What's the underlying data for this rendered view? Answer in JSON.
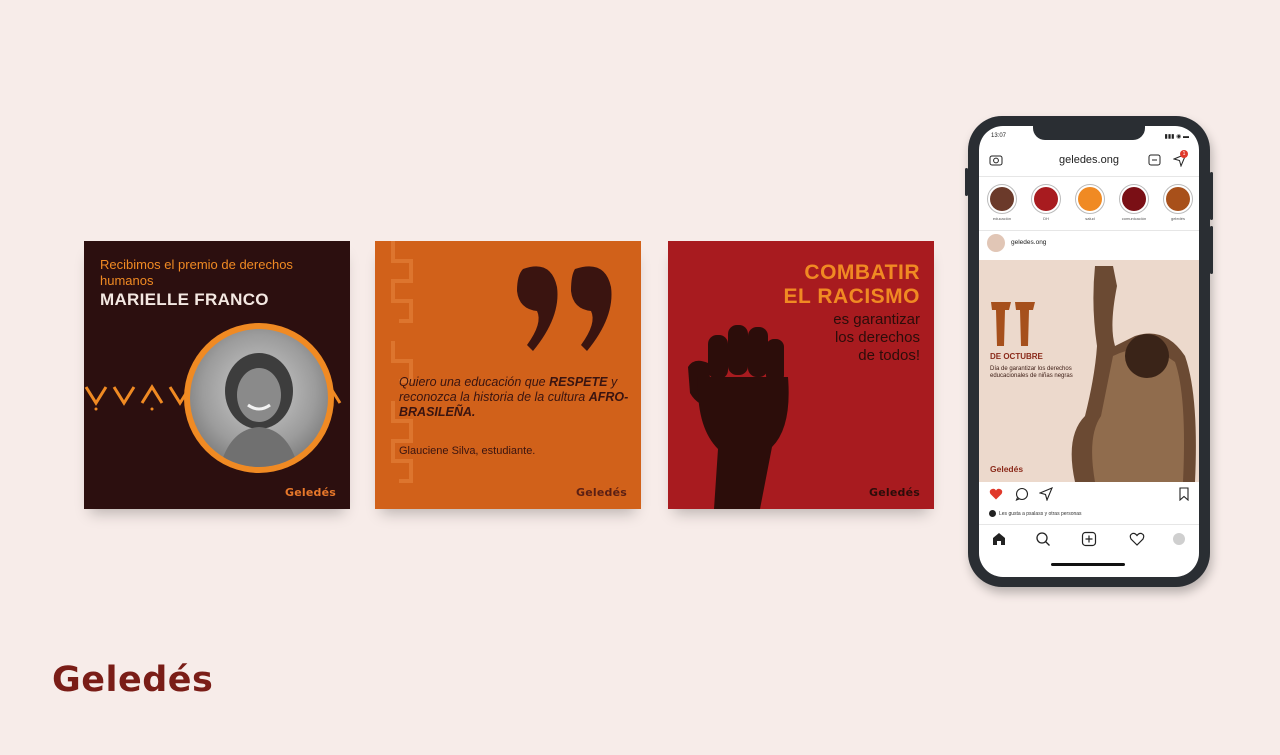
{
  "cards": {
    "award": {
      "intro": "Recibimos el premio de derechos humanos",
      "name": "MARIELLE FRANCO",
      "logo": "Geledés"
    },
    "quote": {
      "text_pre": "Quiero una educación que ",
      "text_em1": "RESPETE",
      "text_mid": " y reconozca la historia de la cultura ",
      "text_em2": "AFRO-BRASILEÑA.",
      "author": "Glauciene Silva, estudiante.",
      "logo": "Geledés"
    },
    "racism": {
      "headline_1": "COMBATIR",
      "headline_2": "EL RACISMO",
      "sub_1": "es garantizar",
      "sub_2": "los derechos",
      "sub_3": "de todos!",
      "logo": "Geledés"
    }
  },
  "phone": {
    "status_time": "13:07",
    "app_title": "geledes.ong",
    "notification_count": "1",
    "stories": [
      {
        "label": "educación",
        "color": "#6b3a2a"
      },
      {
        "label": "DH",
        "color": "#a81b1f"
      },
      {
        "label": "salud",
        "color": "#f08a23"
      },
      {
        "label": "comunicación",
        "color": "#7a0f15"
      },
      {
        "label": "geledés",
        "color": "#a8501a"
      }
    ],
    "post": {
      "username": "geledes.ong",
      "day": "11",
      "month": "DE OCTUBRE",
      "description": "Día de garantizar los derechos educacionales de niñas negras",
      "logo": "Geledés"
    },
    "likes_text": "Les gusta a psalass y otras personas"
  },
  "brand": {
    "logo": "Geledés"
  },
  "colors": {
    "background": "#f7ece9",
    "dark_brown": "#2c0f0f",
    "orange": "#d1611a",
    "accent_orange": "#f08a23",
    "red": "#a81b1f"
  }
}
